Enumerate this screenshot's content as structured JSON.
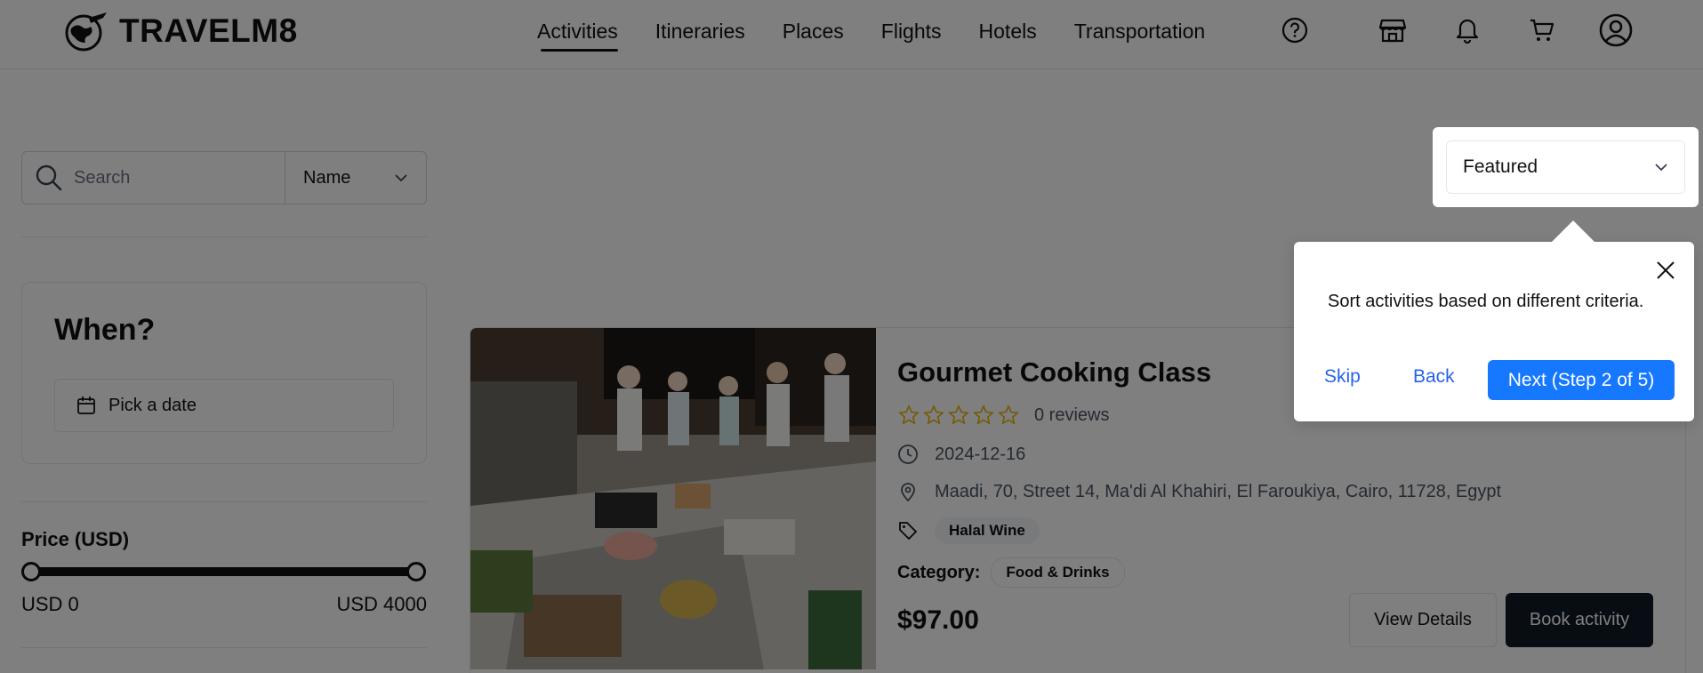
{
  "header": {
    "brand": "TRAVELM8",
    "nav": [
      {
        "label": "Activities",
        "active": true
      },
      {
        "label": "Itineraries"
      },
      {
        "label": "Places"
      },
      {
        "label": "Flights"
      },
      {
        "label": "Hotels"
      },
      {
        "label": "Transportation"
      }
    ],
    "icons": [
      "help-icon",
      "store-icon",
      "bell-icon",
      "cart-icon",
      "user-icon"
    ]
  },
  "sidebar": {
    "search": {
      "placeholder": "Search",
      "value": ""
    },
    "search_by": "Name",
    "when": {
      "title": "When?",
      "date_placeholder": "Pick a date"
    },
    "price": {
      "label": "Price (USD)",
      "min_label": "USD 0",
      "max_label": "USD 4000",
      "min": 0,
      "max": 4000
    }
  },
  "sort": {
    "selected": "Featured"
  },
  "tour": {
    "text": "Sort activities based on different criteria.",
    "skip": "Skip",
    "back": "Back",
    "next": "Next (Step 2 of 5)"
  },
  "activity": {
    "title": "Gourmet Cooking Class",
    "stars": 0,
    "reviews": "0 reviews",
    "date": "2024-12-16",
    "address": "Maadi, 70, Street 14, Ma'di Al Khahiri, El Faroukiya, Cairo, 11728, Egypt",
    "tags": [
      "Halal Wine"
    ],
    "category_label": "Category:",
    "category": "Food & Drinks",
    "price": "$97.00",
    "view_details": "View Details",
    "book": "Book activity"
  },
  "colors": {
    "accent": "#1677ff",
    "star": "#eab308",
    "dark_button": "#111827"
  }
}
